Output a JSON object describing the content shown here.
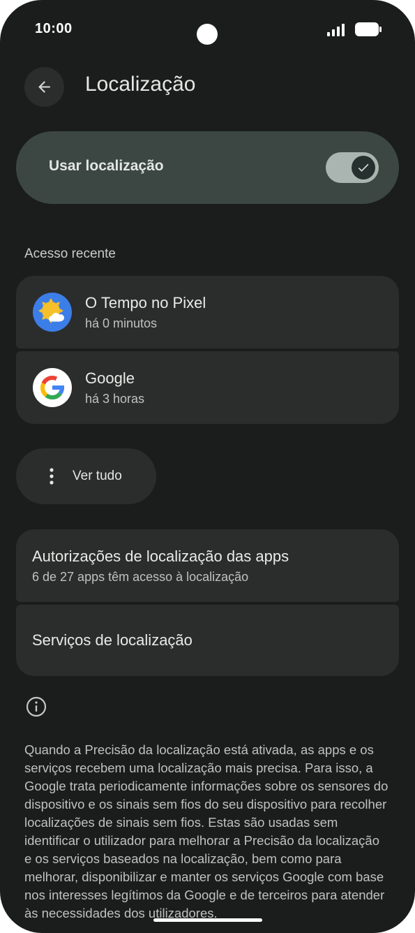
{
  "status_bar": {
    "time": "10:00"
  },
  "header": {
    "title": "Localização"
  },
  "use_location": {
    "label": "Usar localização",
    "enabled": true
  },
  "recent_access": {
    "heading": "Acesso recente",
    "items": [
      {
        "name": "O Tempo no Pixel",
        "time": "há 0 minutos",
        "icon": "weather-sun-cloud-icon"
      },
      {
        "name": "Google",
        "time": "há 3 horas",
        "icon": "google-g-icon"
      }
    ]
  },
  "see_all": {
    "label": "Ver tudo",
    "icon": "more-vertical-icon"
  },
  "settings_items": [
    {
      "title": "Autorizações de localização das apps",
      "subtitle": "6 de 27 apps têm acesso à localização"
    },
    {
      "title": "Serviços de localização"
    }
  ],
  "info": {
    "icon": "info-icon",
    "text": "Quando a Precisão da localização está ativada, as apps e os serviços recebem uma localização mais precisa. Para isso, a Google trata periodicamente informações sobre os sensores do dispositivo e os sinais sem fios do seu dispositivo para recolher localizações de sinais sem fios. Estas são usadas sem identificar o utilizador para melhorar a Precisão da localização e os serviços baseados na localização, bem como para melhorar, disponibilizar e manter os serviços Google com base nos interesses legítimos da Google e de terceiros para atender às necessidades dos utilizadores."
  },
  "colors": {
    "background": "#1b1c1c",
    "card": "#2b2c2c",
    "toggle_container": "#3c4744",
    "toggle_track": "#aab4b0"
  }
}
